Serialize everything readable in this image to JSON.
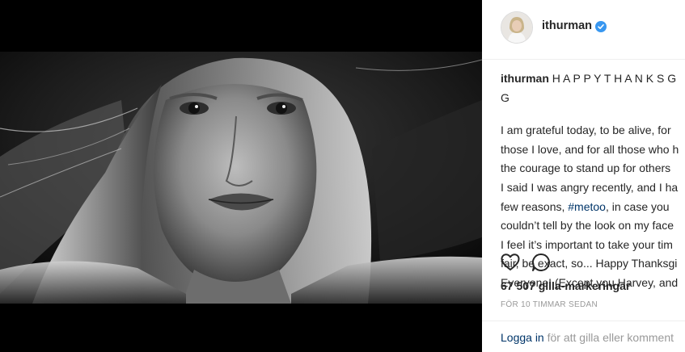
{
  "post": {
    "image_alt": "Black and white close-up portrait photo",
    "header": {
      "username": "ithurman",
      "verified_icon": "verified-badge-icon",
      "verified_color": "#3897f0"
    },
    "caption": {
      "username": "ithurman",
      "title_line1": "H A P P Y T H A N K S G",
      "title_line2": "G",
      "lines": [
        "I am grateful today, to be alive, for",
        "those I love, and for all those who h",
        "the courage to stand up for others",
        "I said I was angry recently, and I ha"
      ],
      "line5_prefix": "few reasons, ",
      "hashtag": "#metoo",
      "line5_suffix": ", in case you",
      "lines_after": [
        "couldn’t tell by the look on my face",
        "I feel it’s important to take your tim",
        "fair, be exact, so... Happy Thanksgi",
        "Everyone! (Except you Harvey, and"
      ]
    },
    "actions": {
      "like_icon": "heart-icon",
      "comment_icon": "comment-icon"
    },
    "likes": "67 507 gilla-markeringar",
    "timestamp": "FÖR 10 TIMMAR SEDAN",
    "footer": {
      "login_label": "Logga in",
      "rest_text": " för att gilla eller komment"
    }
  }
}
